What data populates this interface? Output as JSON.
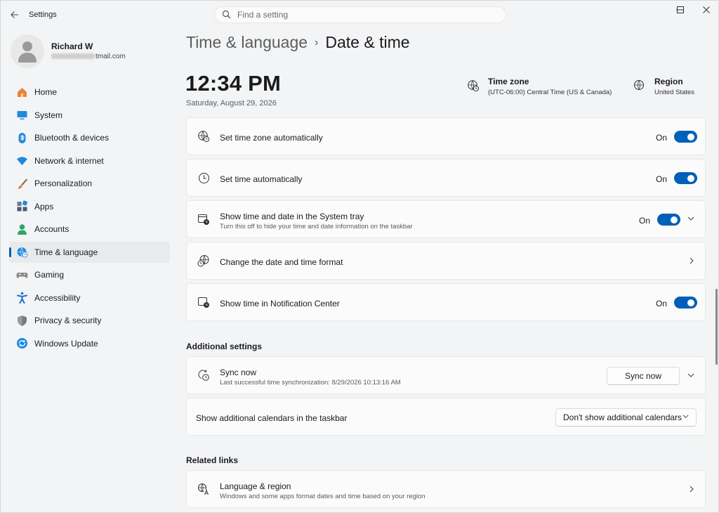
{
  "app": {
    "title": "Settings"
  },
  "search": {
    "placeholder": "Find a setting"
  },
  "profile": {
    "name": "Richard W",
    "email_suffix": "tmail.com"
  },
  "sidebar": {
    "items": [
      {
        "label": "Home",
        "icon": "home-icon",
        "color": "#e8853a"
      },
      {
        "label": "System",
        "icon": "system-icon",
        "color": "#1d8ae0"
      },
      {
        "label": "Bluetooth & devices",
        "icon": "bluetooth-icon",
        "color": "#1d8ae0"
      },
      {
        "label": "Network & internet",
        "icon": "wifi-icon",
        "color": "#1d8ae0"
      },
      {
        "label": "Personalization",
        "icon": "brush-icon",
        "color": "#e07a3a"
      },
      {
        "label": "Apps",
        "icon": "apps-icon",
        "color": "#4a5a7a"
      },
      {
        "label": "Accounts",
        "icon": "accounts-icon",
        "color": "#2ea36a"
      },
      {
        "label": "Time & language",
        "icon": "globe-clock-icon",
        "color": "#1d8ae0",
        "active": true
      },
      {
        "label": "Gaming",
        "icon": "gamepad-icon",
        "color": "#8a8a8a"
      },
      {
        "label": "Accessibility",
        "icon": "accessibility-icon",
        "color": "#1d6fd0"
      },
      {
        "label": "Privacy & security",
        "icon": "shield-icon",
        "color": "#7a7a7a"
      },
      {
        "label": "Windows Update",
        "icon": "update-icon",
        "color": "#1d8ae0"
      }
    ]
  },
  "breadcrumb": {
    "parent": "Time & language",
    "separator": "›",
    "current": "Date & time"
  },
  "clock": {
    "time": "12:34 PM",
    "date": "Saturday, August 29, 2026"
  },
  "timezone": {
    "label": "Time zone",
    "value": "(UTC-06:00) Central Time (US & Canada)"
  },
  "region": {
    "label": "Region",
    "value": "United States"
  },
  "settings": {
    "tz_auto": {
      "title": "Set time zone automatically",
      "state": "On"
    },
    "time_auto": {
      "title": "Set time automatically",
      "state": "On"
    },
    "tray": {
      "title": "Show time and date in the System tray",
      "subtitle": "Turn this off to hide your time and date information on the taskbar",
      "state": "On"
    },
    "format": {
      "title": "Change the date and time format"
    },
    "notif": {
      "title": "Show time in Notification Center",
      "state": "On"
    }
  },
  "additional": {
    "heading": "Additional settings",
    "sync": {
      "title": "Sync now",
      "subtitle": "Last successful time synchronization: 8/29/2026 10:13:16 AM",
      "button": "Sync now"
    },
    "calendars": {
      "title": "Show additional calendars in the taskbar",
      "selected": "Don't show additional calendars"
    }
  },
  "related": {
    "heading": "Related links",
    "language": {
      "title": "Language & region",
      "subtitle": "Windows and some apps format dates and time based on your region"
    }
  },
  "theme": {
    "accent": "#005fb8"
  }
}
